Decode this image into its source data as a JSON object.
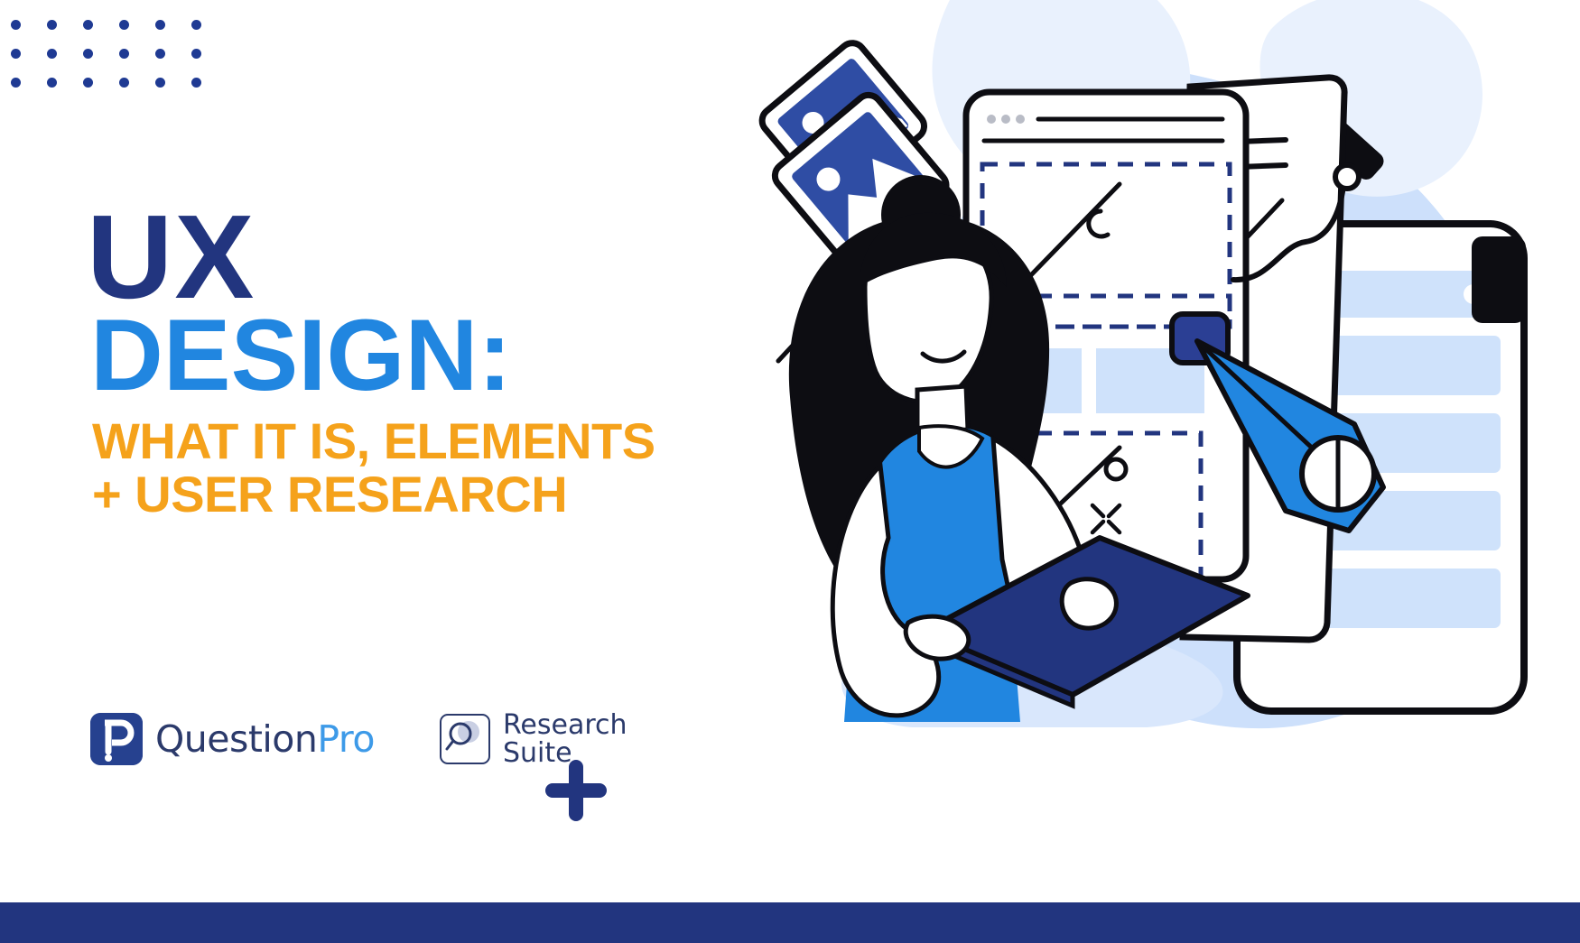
{
  "page": {
    "background": "#ffffff",
    "bottom_bar_color": "#22357f"
  },
  "decor": {
    "dot_grid": {
      "name": "dot-grid",
      "rows": 3,
      "cols": 6,
      "color": "#1f3a93"
    },
    "plus": {
      "name": "plus-mark",
      "color": "#22357f"
    }
  },
  "headline": {
    "line1": "UX",
    "line2": "DESIGN:",
    "line3": "WHAT IT IS, ELEMENTS",
    "line4": "+ USER RESEARCH",
    "colors": {
      "line1": "#22357f",
      "line2": "#2186e0",
      "line3": "#f5a21b",
      "line4": "#f5a21b"
    }
  },
  "brand": {
    "questionpro": {
      "icon": "questionpro-p-mark",
      "word_main": "Question",
      "word_accent": "Pro",
      "color_main": "#2b3a6b",
      "color_accent": "#3d9ae8"
    },
    "research_suite": {
      "icon": "magnifier-icon",
      "line1": "Research",
      "line2": "Suite",
      "color": "#2b3a6b"
    }
  },
  "illustration": {
    "name": "ux-design-hero-illustration",
    "alt": "Woman with laptop surrounded by wireframe screens, image tiles, a pen tool and a mobile device",
    "palette": {
      "blob_light": "#e8f0fd",
      "blob_mid": "#bdd7f8",
      "blue": "#2186e0",
      "navy": "#26418f",
      "ink": "#0d0d12",
      "panel_tint": "#cfe2fb"
    },
    "elements": [
      "background-blob",
      "image-tile-back",
      "image-tile-front",
      "wireframe-browser-card",
      "dashed-wireframe-regions",
      "mobile-device-card",
      "pen-tool-cursor",
      "person-with-laptop",
      "pen-path-node",
      "sparkle-marker"
    ]
  }
}
